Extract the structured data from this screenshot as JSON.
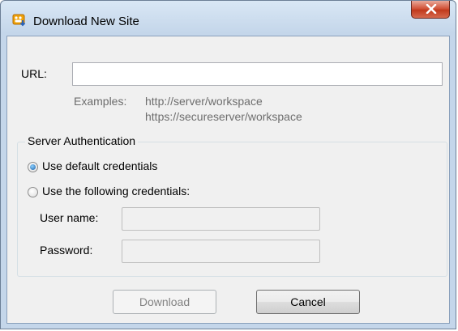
{
  "window": {
    "title": "Download New Site"
  },
  "url": {
    "label": "URL:",
    "value": ""
  },
  "examples": {
    "label": "Examples:",
    "lines": [
      "http://server/workspace",
      "https://secureserver/workspace"
    ]
  },
  "auth": {
    "title": "Server Authentication",
    "option_default": "Use default credentials",
    "option_custom": "Use the following credentials:",
    "selected": "default",
    "username_label": "User name:",
    "password_label": "Password:"
  },
  "buttons": {
    "download": "Download",
    "cancel": "Cancel"
  },
  "icons": {
    "app": "site-download-icon",
    "close": "close-icon"
  },
  "colors": {
    "close_button": "#c13a1c",
    "radio_selected": "#1a5ea6"
  }
}
